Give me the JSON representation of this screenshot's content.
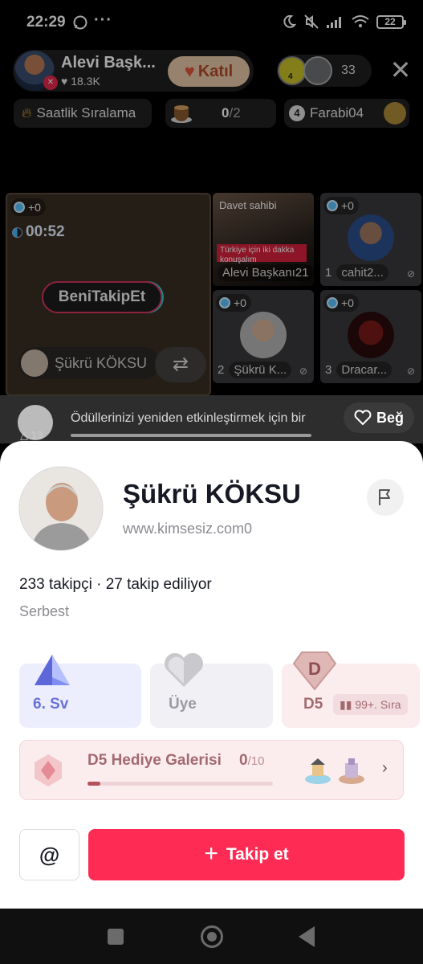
{
  "status": {
    "time": "22:29",
    "more": "···",
    "battery": "22"
  },
  "live": {
    "host_name": "Alevi Başk...",
    "host_likes": "18.3K",
    "join_label": "Katıl",
    "viewer_level": "4",
    "viewer_count": "33",
    "ranking_label": "Saatlik Sıralama",
    "coffee_count": "0",
    "coffee_total": "/2",
    "top_rank": "4",
    "top_user": "Farabi04"
  },
  "stage": {
    "main_tag": "+0",
    "timer": "00:52",
    "bubble": "BeniTakipEt",
    "main_user": "Şükrü KÖKSU",
    "host_badge": "Davet sahibi",
    "host_banner": "Türkiye için iki dakka konuşalım",
    "host_name": "Alevi Başkanı21",
    "cells": [
      {
        "tag": "+0",
        "num": "1",
        "name": "cahit2..."
      },
      {
        "tag": "+0",
        "num": "2",
        "name": "Şükrü K..."
      },
      {
        "tag": "+0",
        "num": "3",
        "name": "Dracar..."
      }
    ]
  },
  "reward": {
    "level": "13",
    "text": "Ödüllerinizi yeniden etkinleştirmek için bir",
    "like_label": "Beğ"
  },
  "profile": {
    "name": "Şükrü KÖKSU",
    "website": "www.kimsesiz.com0",
    "stats": "233 takipçi · 27 takip ediliyor",
    "bio": "Serbest",
    "badges": {
      "sv_label": "6. Sv",
      "uye_label": "Üye",
      "d5_label": "D5",
      "d5_rank": "99+. Sıra",
      "d5_letter": "D"
    },
    "gallery": {
      "title": "D5 Hediye Galerisi",
      "count": "0",
      "total": "/10",
      "progress": 0.07
    },
    "at_label": "@",
    "follow_label": "Takip et"
  },
  "colors": {
    "accent": "#fe2c55",
    "d5": "#a26a6f",
    "sv": "#6a72d8"
  }
}
